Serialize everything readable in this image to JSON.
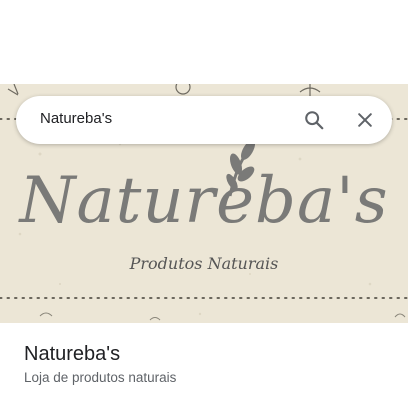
{
  "search": {
    "query": "Natureba's"
  },
  "hero": {
    "logo_wordmark": "Natureba's",
    "logo_tagline": "Produtos Naturais"
  },
  "place": {
    "name": "Natureba's",
    "category": "Loja de produtos naturais"
  },
  "icons": {
    "search": "search-icon",
    "close": "close-icon"
  }
}
